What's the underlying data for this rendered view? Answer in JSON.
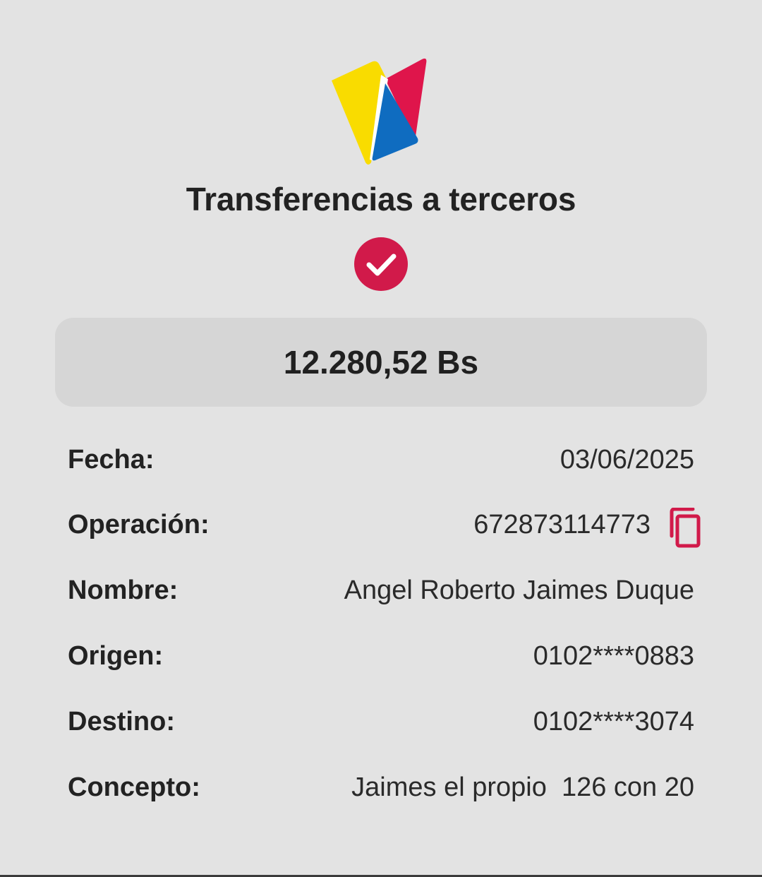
{
  "header": {
    "logo_icon": "bank-logo-icon",
    "title": "Transferencias a terceros",
    "status_icon": "success-check-icon"
  },
  "colors": {
    "background": "#e3e3e3",
    "amount_box": "#d6d6d6",
    "accent": "#d11a4a",
    "logo_yellow": "#f9dc00",
    "logo_blue": "#0f6cc0",
    "logo_red": "#df154b"
  },
  "amount": "12.280,52 Bs",
  "details": {
    "fecha": {
      "label": "Fecha:",
      "value": "03/06/2025"
    },
    "operacion": {
      "label": "Operación:",
      "value": "672873114773",
      "icon": "copy-icon"
    },
    "nombre": {
      "label": "Nombre:",
      "value": "Angel Roberto Jaimes Duque"
    },
    "origen": {
      "label": "Origen:",
      "value": "0102****0883"
    },
    "destino": {
      "label": "Destino:",
      "value": "0102****3074"
    },
    "concepto": {
      "label": "Concepto:",
      "value": "Jaimes el propio  126 con 20"
    }
  }
}
